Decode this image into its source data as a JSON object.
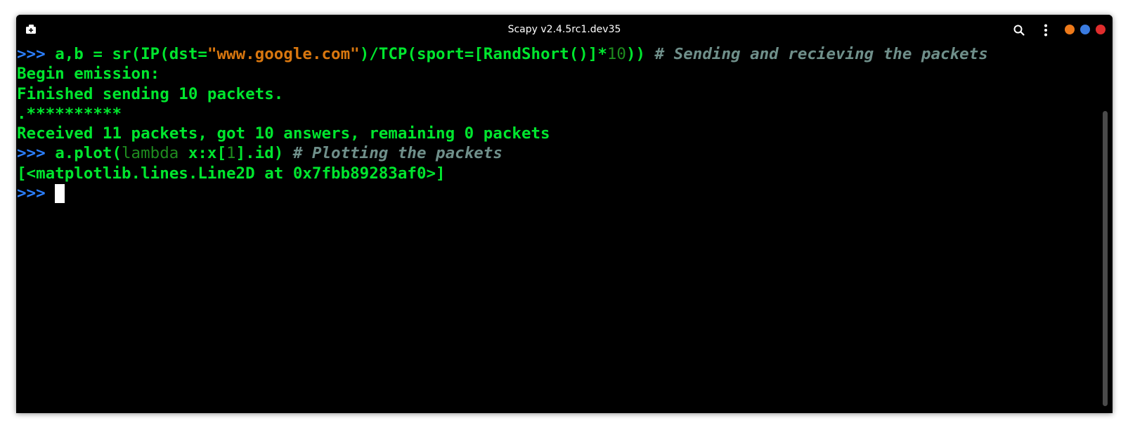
{
  "window": {
    "title": "Scapy v2.4.5rc1.dev35"
  },
  "icons": {
    "new_tab": "new-tab-icon",
    "search": "search-icon",
    "menu": "kebab-menu-icon",
    "minimize": "minimize-icon",
    "maximize": "maximize-icon",
    "close": "close-icon"
  },
  "colors": {
    "minimize": "#ee7a1a",
    "maximize": "#3a7be0",
    "close": "#e02d2d",
    "output_text": "#00e62e",
    "prompt": "#2b7fff",
    "string": "#d9770f",
    "comment": "#6f8f8a"
  },
  "terminal": {
    "prompt": ">>>",
    "line1": {
      "code_a": "a,b = sr(IP(dst=",
      "string": "\"www.google.com\"",
      "code_b": ")/TCP(sport=[RandShort()]*",
      "number": "10",
      "code_c": ")) ",
      "comment": "# Sending and recieving the packets"
    },
    "output": [
      "Begin emission:",
      "Finished sending 10 packets.",
      ".**********",
      "Received 11 packets, got 10 answers, remaining 0 packets"
    ],
    "line2": {
      "code_a": "a.plot(",
      "keyword": "lambda",
      "code_b": " x:x[",
      "number": "1",
      "code_c": "].id) ",
      "comment": "# Plotting the packets"
    },
    "result": "[<matplotlib.lines.Line2D at 0x7fbb89283af0>]"
  }
}
